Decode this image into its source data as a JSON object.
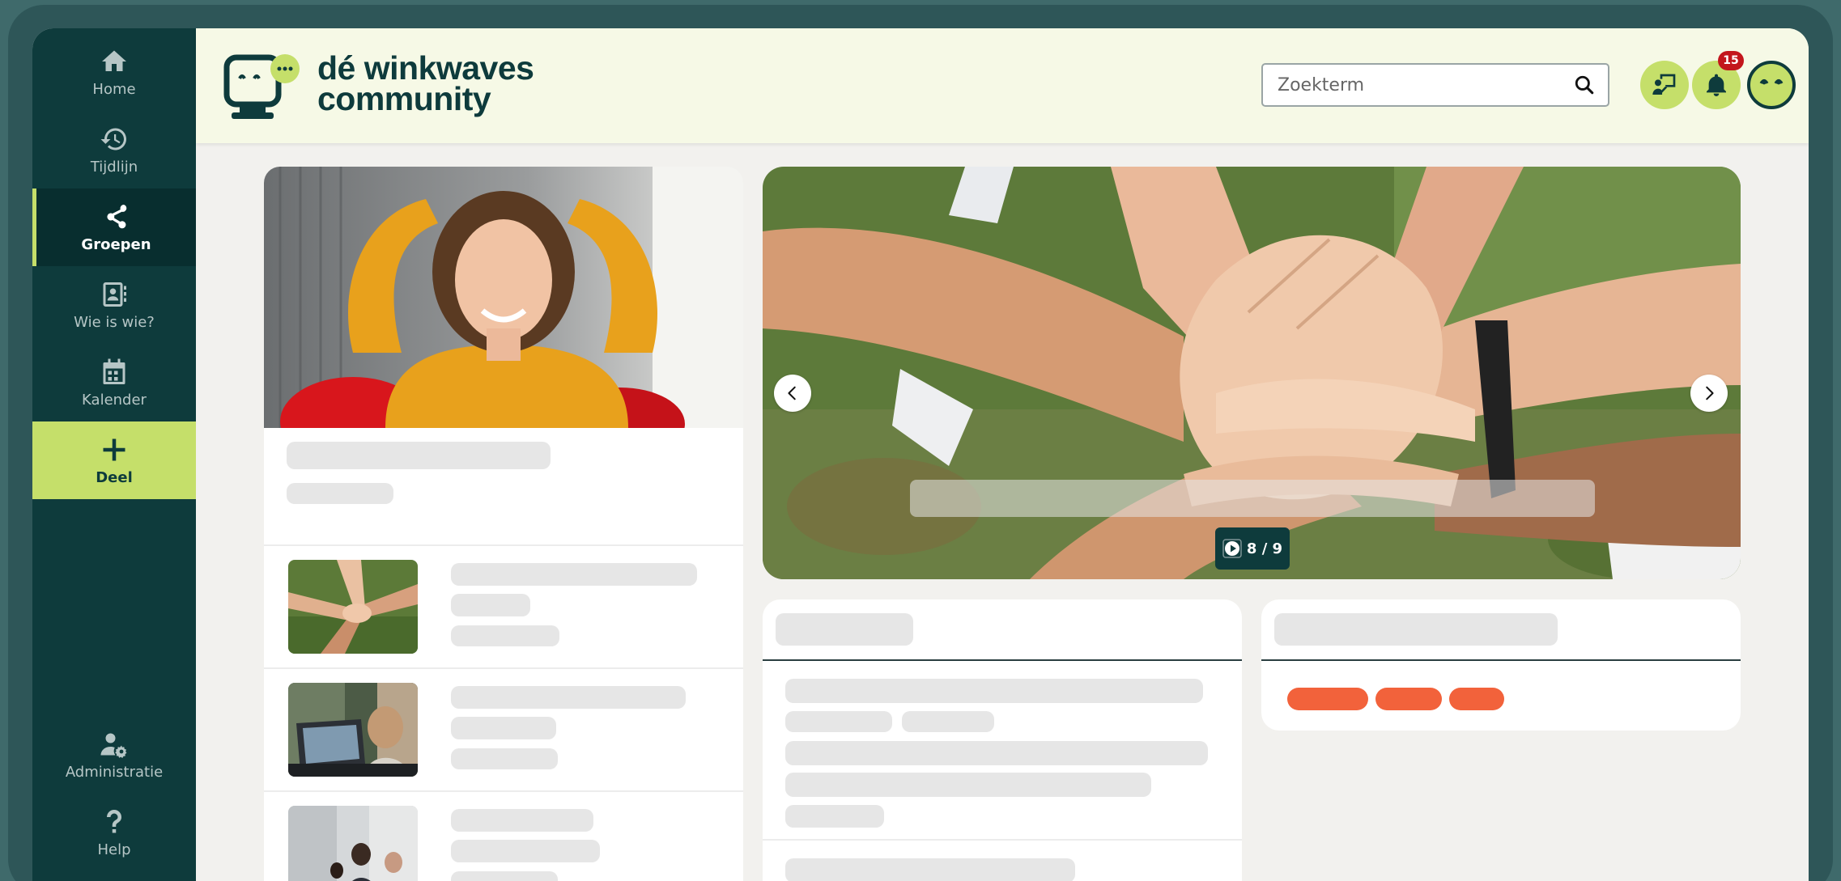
{
  "brand": {
    "line1": "dé winkwaves",
    "line2": "community",
    "primary_color": "#0e3b3c",
    "accent_color": "#c5df6a"
  },
  "sidebar": {
    "items": [
      {
        "label": "Home",
        "icon": "home-icon"
      },
      {
        "label": "Tijdlijn",
        "icon": "history-icon"
      },
      {
        "label": "Groepen",
        "icon": "groups-icon",
        "active": true
      },
      {
        "label": "Wie is wie?",
        "icon": "contacts-icon"
      },
      {
        "label": "Kalender",
        "icon": "calendar-icon"
      },
      {
        "label": "Deel",
        "icon": "plus-icon"
      }
    ],
    "bottom_items": [
      {
        "label": "Administratie",
        "icon": "user-cog-icon"
      },
      {
        "label": "Help",
        "icon": "question-icon"
      }
    ]
  },
  "header": {
    "search_placeholder": "Zoekterm",
    "notification_count": "15"
  },
  "carousel": {
    "counter": "8 / 9",
    "current": 8,
    "total": 9
  },
  "tag_color": "#f2623b"
}
